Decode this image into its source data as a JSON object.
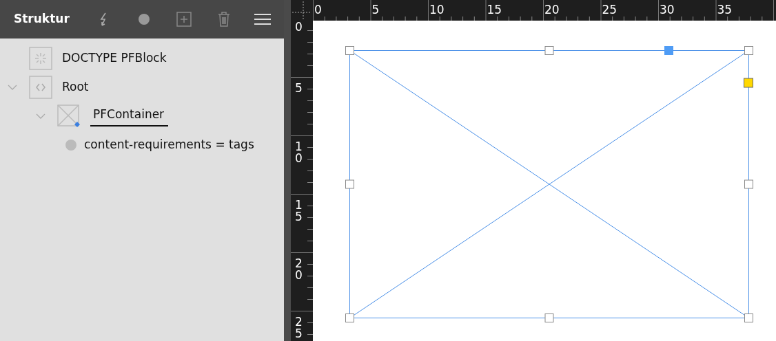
{
  "panel": {
    "title": "Struktur"
  },
  "tree": [
    {
      "kind": "doctype",
      "label": "DOCTYPE PFBlock"
    },
    {
      "kind": "element",
      "label": "Root",
      "expanded": true,
      "children": [
        {
          "kind": "container",
          "label": "PFContainer",
          "expanded": true,
          "editing": true,
          "children": [
            {
              "kind": "attribute",
              "label": "content-requirements = tags"
            }
          ]
        }
      ]
    }
  ],
  "ruler_top": {
    "labels": [
      "0",
      "5",
      "10",
      "15",
      "20",
      "25",
      "30",
      "35"
    ]
  },
  "ruler_left": {
    "labels": [
      "0",
      "5",
      "10",
      "15",
      "20",
      "25"
    ]
  }
}
